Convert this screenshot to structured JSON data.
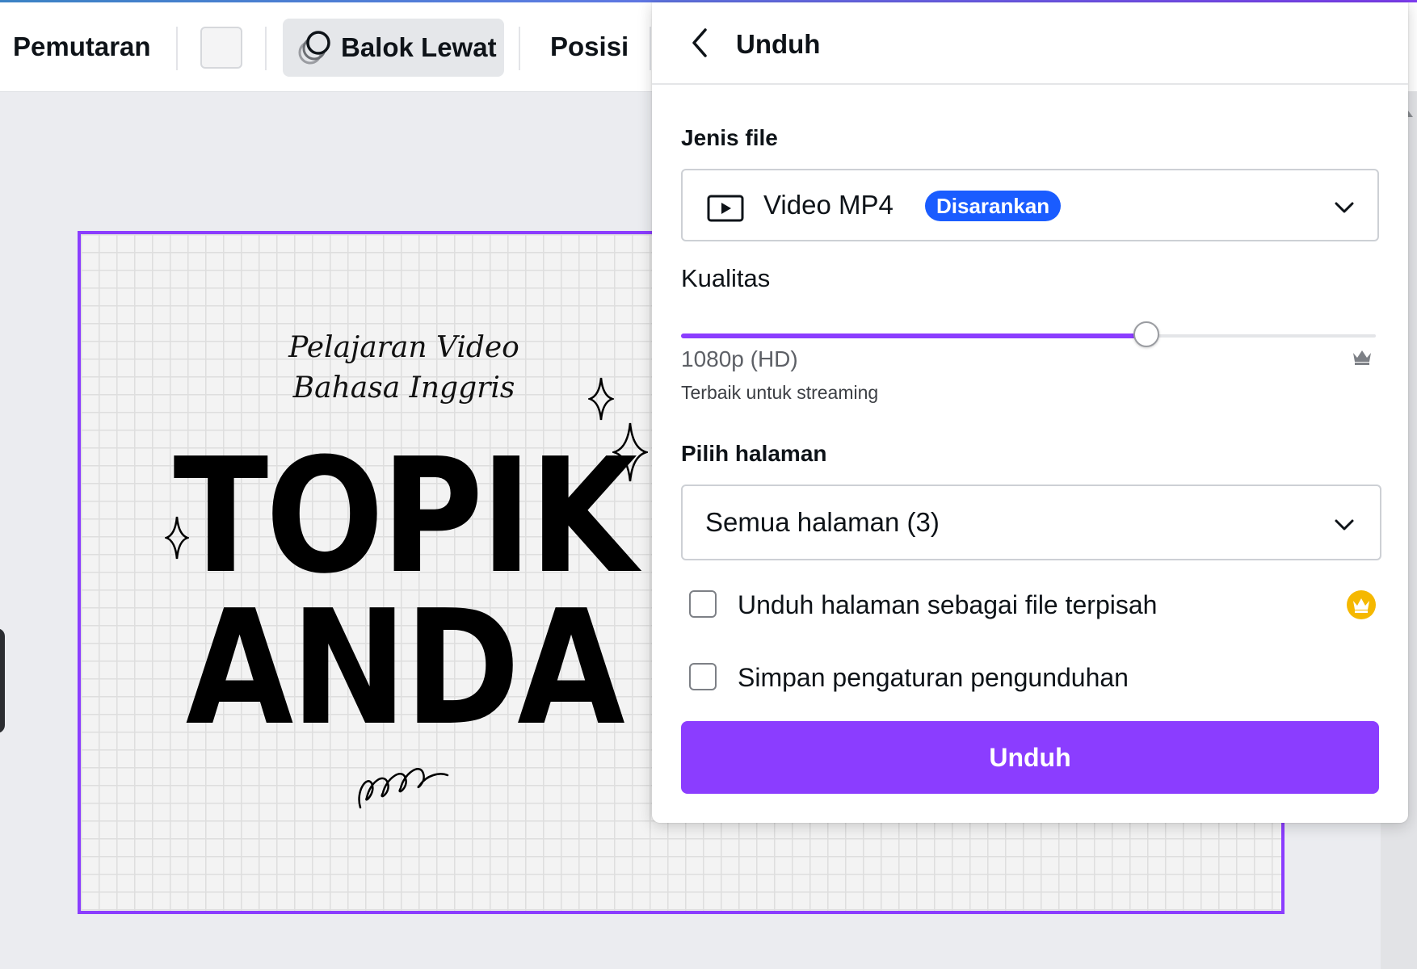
{
  "toolbar": {
    "playback_label": "Pemutaran",
    "effect_label": "Balok Lewat",
    "position_label": "Posisi"
  },
  "canvas": {
    "subtitle_line1": "Pelajaran Video",
    "subtitle_line2": "Bahasa Inggris",
    "title_line1": "TOPIK",
    "title_line2": "ANDA"
  },
  "download_panel": {
    "title": "Unduh",
    "file_type": {
      "label": "Jenis file",
      "value": "Video MP4",
      "badge": "Disarankan"
    },
    "quality": {
      "label": "Kualitas",
      "value": "1080p (HD)",
      "description": "Terbaik untuk streaming",
      "slider_fraction": 0.67
    },
    "pages": {
      "label": "Pilih halaman",
      "value": "Semua halaman (3)"
    },
    "options": [
      {
        "label": "Unduh halaman sebagai file terpisah",
        "checked": false,
        "premium": true
      },
      {
        "label": "Simpan pengaturan pengunduhan",
        "checked": false,
        "premium": false
      }
    ],
    "submit_label": "Unduh"
  },
  "colors": {
    "accent": "#8b3dff",
    "badge": "#1a5cff",
    "premium_crown": "#f5b800"
  },
  "icons": [
    "back-arrow-icon",
    "video-icon",
    "chevron-down-icon",
    "crown-icon",
    "balok-lewat-animation-icon"
  ]
}
